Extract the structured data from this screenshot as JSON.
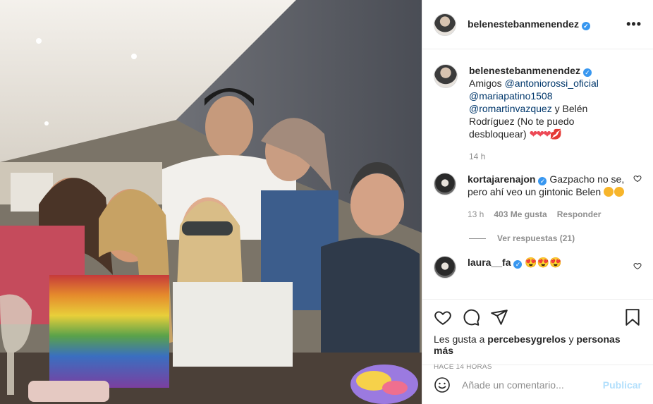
{
  "post": {
    "author": "belenestebanmenendez",
    "caption": {
      "intro": "Amigos",
      "mentions": [
        "@antoniorossi_oficial",
        "@mariapatino1508",
        "@romartinvazquez"
      ],
      "rest": "y Belén Rodríguez (No te puedo desbloquear)",
      "hearts": "❤❤❤",
      "kiss": "💋",
      "time": "14 h"
    },
    "comments": [
      {
        "user": "korta jarenajon",
        "username": "kortajarenajon",
        "text": "Gazpacho no se, pero ahí veo un gintonic Belen",
        "time": "13 h",
        "likes": "403 Me gusta",
        "reply": "Responder",
        "view_replies": "Ver respuestas (21)"
      },
      {
        "username": "laura__fa",
        "text": "😍😍😍"
      }
    ],
    "likes_prefix": "Les gusta a",
    "likes_user": "percebesygrelos",
    "likes_and": "y",
    "likes_more": "personas más",
    "posted_ago": "HACE 14 HORAS",
    "add_comment_placeholder": "Añade un comentario...",
    "publish_label": "Publicar"
  },
  "colors": {
    "link": "#00376b",
    "verified": "#3897f0",
    "publish_disabled": "#b2dffc"
  }
}
